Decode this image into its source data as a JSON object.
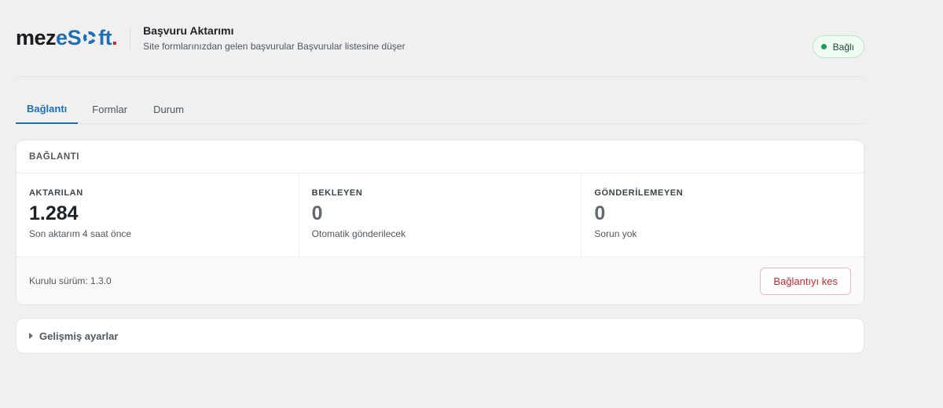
{
  "brand": {
    "logo_part1": "mez",
    "logo_part2": "e",
    "logo_part3": "S",
    "logo_part4": "ft",
    "logo_dot": "."
  },
  "header": {
    "title": "Başvuru Aktarımı",
    "subtitle": "Site formlarınızdan gelen başvurular Başvurular listesine düşer",
    "status": "Bağlı",
    "status_color": "#1f9d55"
  },
  "tabs": [
    {
      "label": "Bağlantı",
      "active": true
    },
    {
      "label": "Formlar",
      "active": false
    },
    {
      "label": "Durum",
      "active": false
    }
  ],
  "connection": {
    "heading": "BAĞLANTI",
    "stats": [
      {
        "label": "AKTARILAN",
        "value": "1.284",
        "desc": "Son aktarım 4 saat önce"
      },
      {
        "label": "BEKLEYEN",
        "value": "0",
        "desc": "Otomatik gönderilecek"
      },
      {
        "label": "GÖNDERİLEMEYEN",
        "value": "0",
        "desc": "Sorun yok"
      }
    ],
    "version": "Kurulu sürüm: 1.3.0",
    "disconnect_label": "Bağlantıyı kes"
  },
  "advanced": {
    "label": "Gelişmiş ayarlar"
  },
  "colors": {
    "accent": "#1f6fb5",
    "danger": "#c8292f",
    "success": "#1f9d55"
  }
}
